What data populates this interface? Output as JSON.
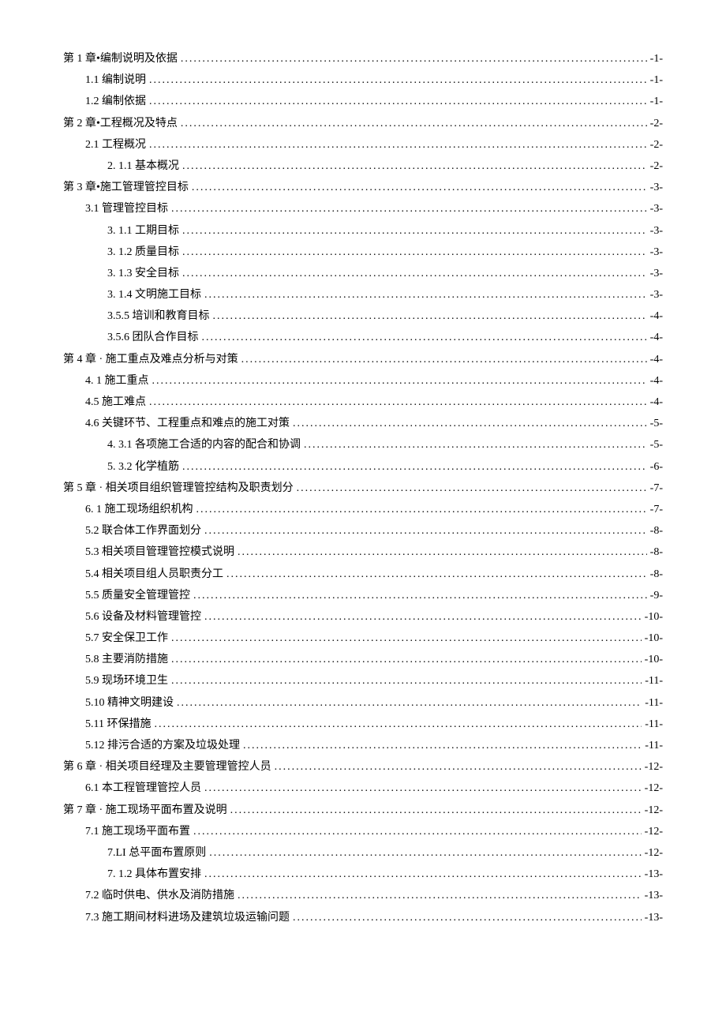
{
  "toc": [
    {
      "indent": 0,
      "title": "第 1 章•编制说明及依据",
      "page": "-1-"
    },
    {
      "indent": 1,
      "title": "1.1 编制说明",
      "page": "-1-"
    },
    {
      "indent": 1,
      "title": "1.2 编制依据",
      "page": "-1-"
    },
    {
      "indent": 0,
      "title": "第 2 章•工程概况及特点",
      "page": "-2-"
    },
    {
      "indent": 1,
      "title": "2.1 工程概况",
      "page": "-2-"
    },
    {
      "indent": 2,
      "title": "2.   1.1 基本概况",
      "page": "-2-"
    },
    {
      "indent": 0,
      "title": "第 3 章•施工管理管控目标",
      "page": "-3-"
    },
    {
      "indent": 1,
      "title": "3.1 管理管控目标",
      "page": "-3-"
    },
    {
      "indent": 2,
      "title": "3.   1.1 工期目标",
      "page": "-3-"
    },
    {
      "indent": 2,
      "title": "3.   1.2 质量目标",
      "page": "-3-"
    },
    {
      "indent": 2,
      "title": "3.   1.3 安全目标",
      "page": "-3-"
    },
    {
      "indent": 2,
      "title": "3.   1.4 文明施工目标",
      "page": "-3-"
    },
    {
      "indent": 2,
      "title": "3.5.5    培训和教育目标",
      "page": "-4-"
    },
    {
      "indent": 2,
      "title": "3.5.6    团队合作目标",
      "page": "-4-"
    },
    {
      "indent": 0,
      "title": "第 4 章 · 施工重点及难点分析与对策",
      "page": "-4-"
    },
    {
      "indent": 1,
      "title": "4.   1 施工重点",
      "page": "-4-"
    },
    {
      "indent": 1,
      "title": "4.5    施工难点",
      "page": "-4-"
    },
    {
      "indent": 1,
      "title": "4.6    关键环节、工程重点和难点的施工对策",
      "page": "-5-"
    },
    {
      "indent": 2,
      "title": "4.   3.1 各项施工合适的内容的配合和协调",
      "page": "-5-"
    },
    {
      "indent": 2,
      "title": "5.   3.2 化学植筋",
      "page": "-6-"
    },
    {
      "indent": 0,
      "title": "第 5 章 · 相关项目组织管理管控结构及职责划分",
      "page": "-7-"
    },
    {
      "indent": 1,
      "title": "6.   1 施工现场组织机构",
      "page": "-7-"
    },
    {
      "indent": 1,
      "title": "5.2    联合体工作界面划分",
      "page": "-8-"
    },
    {
      "indent": 1,
      "title": "5.3    相关项目管理管控模式说明",
      "page": "-8-"
    },
    {
      "indent": 1,
      "title": "5.4    相关项目组人员职责分工",
      "page": "-8-"
    },
    {
      "indent": 1,
      "title": "5.5 质量安全管理管控",
      "page": "-9-"
    },
    {
      "indent": 1,
      "title": "5.6 设备及材料管理管控",
      "page": "-10-"
    },
    {
      "indent": 1,
      "title": "5.7 安全保卫工作",
      "page": "-10-"
    },
    {
      "indent": 1,
      "title": "5.8 主要消防措施",
      "page": "-10-"
    },
    {
      "indent": 1,
      "title": "5.9 现场环境卫生",
      "page": "-11-"
    },
    {
      "indent": 1,
      "title": "5.10 精神文明建设",
      "page": "-11-"
    },
    {
      "indent": 1,
      "title": "5.11    环保措施",
      "page": "-11-"
    },
    {
      "indent": 1,
      "title": "5.12    排污合适的方案及垃圾处理",
      "page": "-11-"
    },
    {
      "indent": 0,
      "title": "第 6 章 · 相关项目经理及主要管理管控人员",
      "page": "-12-"
    },
    {
      "indent": 1,
      "title": "6.1 本工程管理管控人员",
      "page": "-12-"
    },
    {
      "indent": 0,
      "title": "第 7 章 · 施工现场平面布置及说明",
      "page": "-12-"
    },
    {
      "indent": 1,
      "title": "7.1 施工现场平面布置",
      "page": "-12-"
    },
    {
      "indent": 2,
      "title": "7.LI 总平面布置原则",
      "page": "-12-"
    },
    {
      "indent": 2,
      "title": "7.   1.2 具体布置安排",
      "page": "-13-"
    },
    {
      "indent": 1,
      "title": "7.2 临时供电、供水及消防措施",
      "page": "-13-"
    },
    {
      "indent": 1,
      "title": "7.3 施工期间材料进场及建筑垃圾运输问题",
      "page": "-13-"
    }
  ]
}
